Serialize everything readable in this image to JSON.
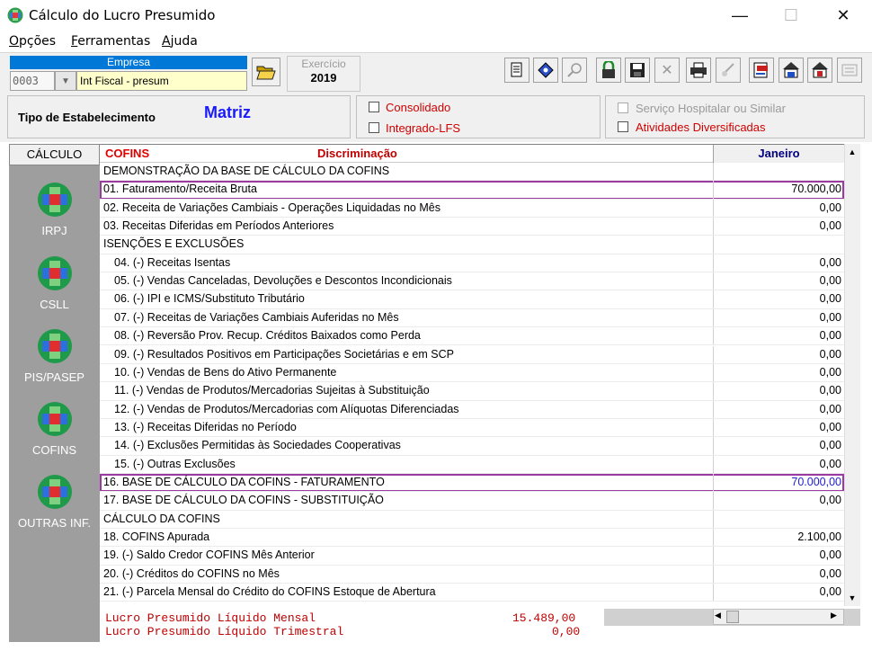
{
  "window": {
    "title": "Cálculo do Lucro Presumido",
    "minimize_glyph": "—",
    "maximize_glyph": "☐",
    "close_glyph": "✕"
  },
  "menu": [
    {
      "label_rest": "pções",
      "mnemonic": "O"
    },
    {
      "label_rest": "erramentas",
      "mnemonic": "F"
    },
    {
      "label_rest": "juda",
      "mnemonic": "A"
    }
  ],
  "empresa": {
    "label": "Empresa",
    "code": "0003",
    "name": "Int Fiscal -  presum"
  },
  "exercicio": {
    "label": "Exercício",
    "year": "2019"
  },
  "toolbar_icons": [
    "document-icon",
    "navigate-icon",
    "search-icon",
    "lock-icon",
    "save-icon",
    "delete-icon",
    "print-icon",
    "brush-icon",
    "export-icon",
    "house-print-icon",
    "house-calc-icon",
    "report-icon"
  ],
  "tipo": {
    "label": "Tipo de Estabelecimento",
    "value": "Matriz"
  },
  "options": {
    "consolidado": "Consolidado",
    "integrado": "Integrado-LFS",
    "servico_hospitalar": "Serviço Hospitalar ou Similar",
    "atividades": "Atividades Diversificadas"
  },
  "sidebar": {
    "header": "CÁLCULO",
    "items": [
      "IRPJ",
      "CSLL",
      "PIS/PASEP",
      "COFINS",
      "OUTRAS INF."
    ]
  },
  "grid": {
    "col_tax": "COFINS",
    "col_desc": "Discriminação",
    "col_month": "Janeiro",
    "rows": [
      {
        "desc": "DEMONSTRAÇÃO DA BASE DE CÁLCULO DA COFINS",
        "value": ""
      },
      {
        "desc": "01. Faturamento/Receita Bruta",
        "value": "70.000,00"
      },
      {
        "desc": "02. Receita de Variações Cambiais - Operações Liquidadas no Mês",
        "value": "0,00"
      },
      {
        "desc": "03. Receitas Diferidas em Períodos Anteriores",
        "value": "0,00"
      },
      {
        "desc": "ISENÇÕES E EXCLUSÕES",
        "value": ""
      },
      {
        "desc": "04. (-) Receitas Isentas",
        "value": "0,00"
      },
      {
        "desc": "05. (-) Vendas Canceladas, Devoluções e Descontos Incondicionais",
        "value": "0,00"
      },
      {
        "desc": "06. (-) IPI e ICMS/Substituto Tributário",
        "value": "0,00"
      },
      {
        "desc": "07. (-) Receitas de Variações Cambiais Auferidas no Mês",
        "value": "0,00"
      },
      {
        "desc": "08. (-) Reversão Prov. Recup. Créditos Baixados como Perda",
        "value": "0,00"
      },
      {
        "desc": "09. (-) Resultados Positivos em Participações Societárias e em SCP",
        "value": "0,00"
      },
      {
        "desc": "10. (-) Vendas de Bens do Ativo Permanente",
        "value": "0,00"
      },
      {
        "desc": "11. (-) Vendas de Produtos/Mercadorias Sujeitas à Substituição",
        "value": "0,00"
      },
      {
        "desc": "12. (-) Vendas de Produtos/Mercadorias com Alíquotas Diferenciadas",
        "value": "0,00"
      },
      {
        "desc": "13. (-) Receitas Diferidas no Período",
        "value": "0,00"
      },
      {
        "desc": "14. (-) Exclusões Permitidas às Sociedades Cooperativas",
        "value": "0,00"
      },
      {
        "desc": "15. (-) Outras Exclusões",
        "value": "0,00"
      },
      {
        "desc": "16. BASE DE CÁLCULO DA COFINS - FATURAMENTO",
        "value": "70.000,00"
      },
      {
        "desc": "17. BASE DE CÁLCULO DA COFINS - SUBSTITUIÇÃO",
        "value": "0,00"
      },
      {
        "desc": "CÁLCULO DA COFINS",
        "value": ""
      },
      {
        "desc": "18. COFINS Apurada",
        "value": "2.100,00"
      },
      {
        "desc": "19. (-) Saldo Credor COFINS Mês Anterior",
        "value": "0,00"
      },
      {
        "desc": "20. (-) Créditos do COFINS no Mês",
        "value": "0,00"
      },
      {
        "desc": "21. (-) Parcela Mensal do Crédito do COFINS Estoque de Abertura",
        "value": "0,00"
      }
    ]
  },
  "footer": {
    "mensal_label": "Lucro Presumido Líquido Mensal",
    "mensal_value": "15.489,00",
    "trimestral_label": "Lucro Presumido Líquido Trimestral",
    "trimestral_value": "0,00"
  },
  "colors": {
    "accent_blue": "#0078d7",
    "highlight_border": "#9b3aa0",
    "header_red": "#e00000",
    "footer_red": "#c00000",
    "matriz_blue": "#1a1aff"
  }
}
